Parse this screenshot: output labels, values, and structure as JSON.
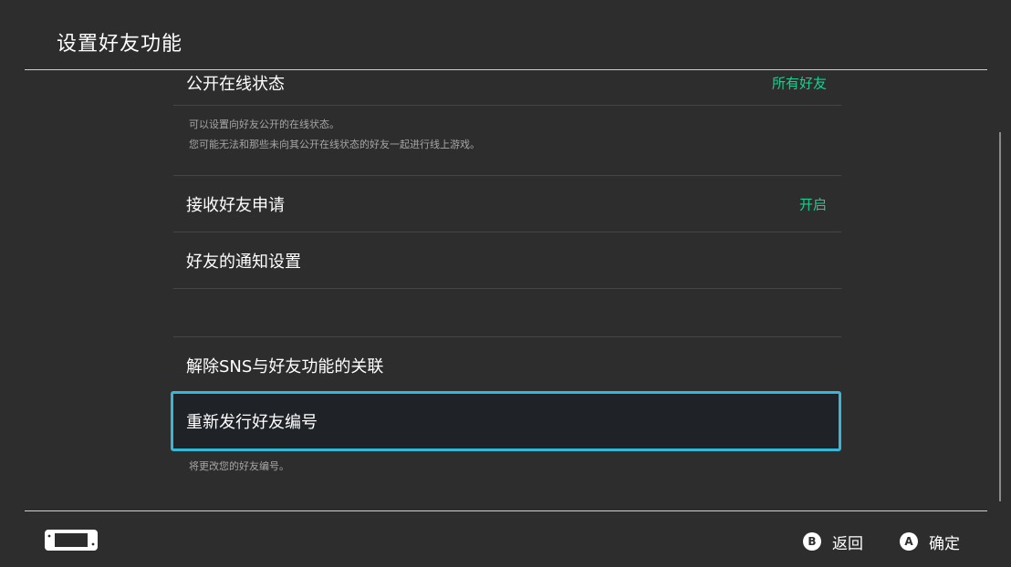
{
  "header": {
    "title": "设置好友功能"
  },
  "settings": {
    "online_status": {
      "label": "公开在线状态",
      "value": "所有好友",
      "desc_line1": "可以设置向好友公开的在线状态。",
      "desc_line2": "您可能无法和那些未向其公开在线状态的好友一起进行线上游戏。"
    },
    "friend_requests": {
      "label": "接收好友申请",
      "value": "开启"
    },
    "notifications": {
      "label": "好友的通知设置"
    },
    "unlink_sns": {
      "label": "解除SNS与好友功能的关联"
    },
    "reissue_code": {
      "label": "重新发行好友编号",
      "desc": "将更改您的好友编号。"
    }
  },
  "footer": {
    "console_icon": "console-handheld-icon",
    "back": {
      "button": "B",
      "label": "返回"
    },
    "confirm": {
      "button": "A",
      "label": "确定"
    }
  },
  "colors": {
    "background": "#2d2d2d",
    "accent_value": "#15d08f",
    "selection_border": "#37b7d8"
  }
}
